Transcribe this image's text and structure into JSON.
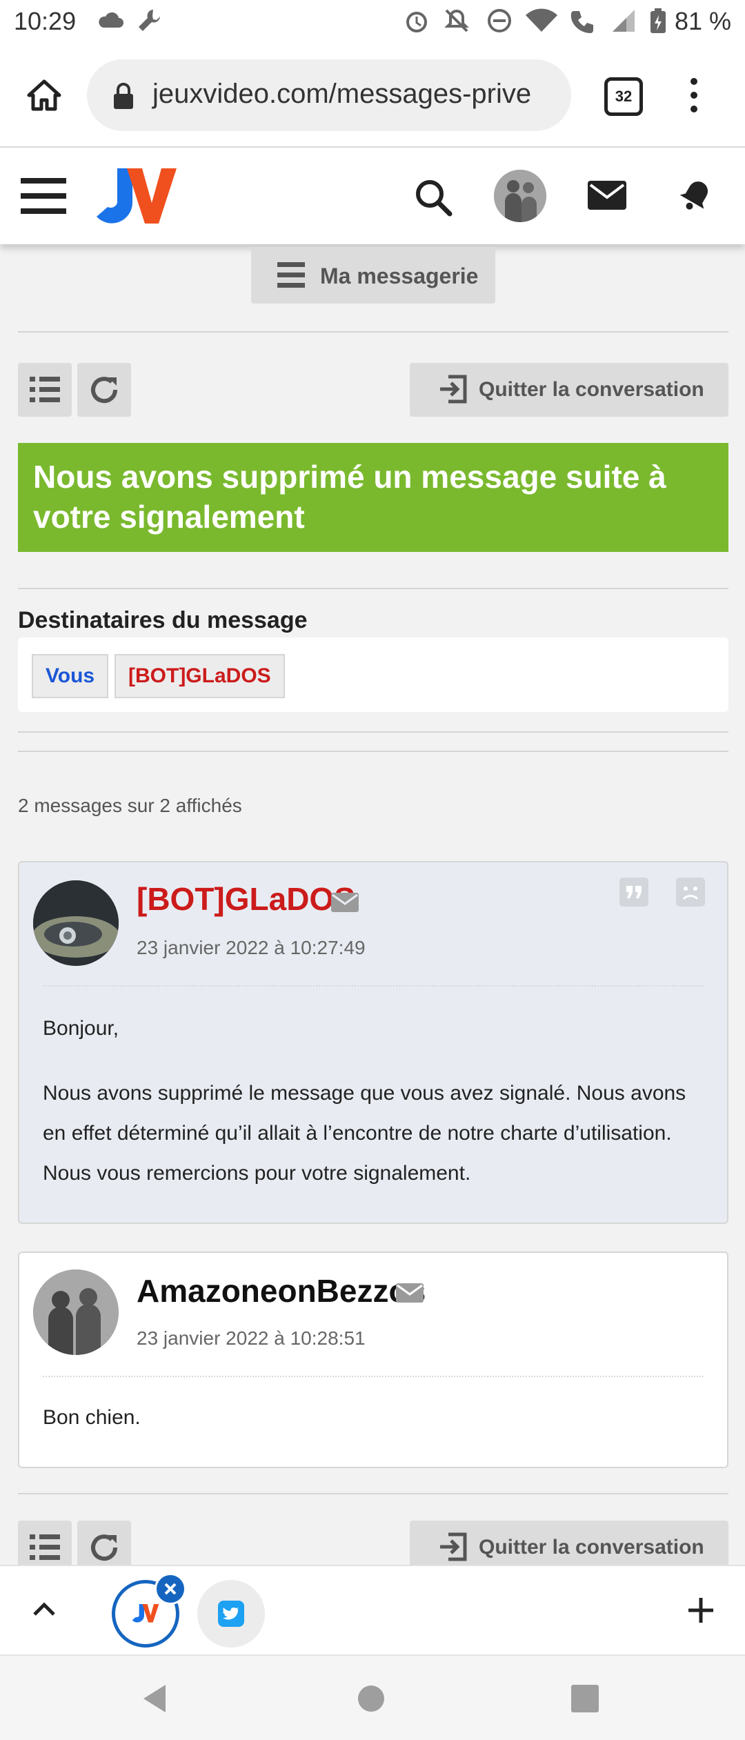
{
  "status_bar": {
    "time": "10:29",
    "battery": "81 %",
    "icons": [
      "cloud-icon",
      "wrench-icon",
      "alarm-icon",
      "notifications-off-icon",
      "do-not-disturb-icon",
      "wifi-icon",
      "wifi-calling-icon",
      "signal-icon",
      "battery-icon"
    ]
  },
  "browser": {
    "url": "jeuxvideo.com/messages-prive",
    "tab_count": "32"
  },
  "header": {
    "logo_text": "JV"
  },
  "messagerie_button": "Ma messagerie",
  "toolbar": {
    "quit_label": "Quitter la conversation"
  },
  "banner": {
    "text": "Nous avons supprimé un message suite à votre signalement",
    "color": "#7ab92e"
  },
  "recipients": {
    "title": "Destinataires du message",
    "items": [
      {
        "label": "Vous",
        "color": "#1a56d6"
      },
      {
        "label": "[BOT]GLaDOS",
        "color": "#cc1b1b"
      }
    ]
  },
  "count_text": "2 messages sur 2 affichés",
  "messages": [
    {
      "author": "[BOT]GLaDOS",
      "author_color": "#cc1b1b",
      "date": "23 janvier 2022 à 10:27:49",
      "body": [
        "Bonjour,",
        "Nous avons supprimé le message que vous avez signalé. Nous avons en effet déterminé qu’il allait à l’encontre de notre charte d’utilisation. Nous vous remercions pour votre signalement."
      ]
    },
    {
      "author": "AmazoneonBezzos",
      "author_color": "#111111",
      "date": "23 janvier 2022 à 10:28:51",
      "body": [
        "Bon chien."
      ]
    }
  ],
  "colors": {
    "accent_blue": "#1565c0",
    "logo_orange": "#f0501e",
    "logo_blue": "#1a73e8"
  }
}
